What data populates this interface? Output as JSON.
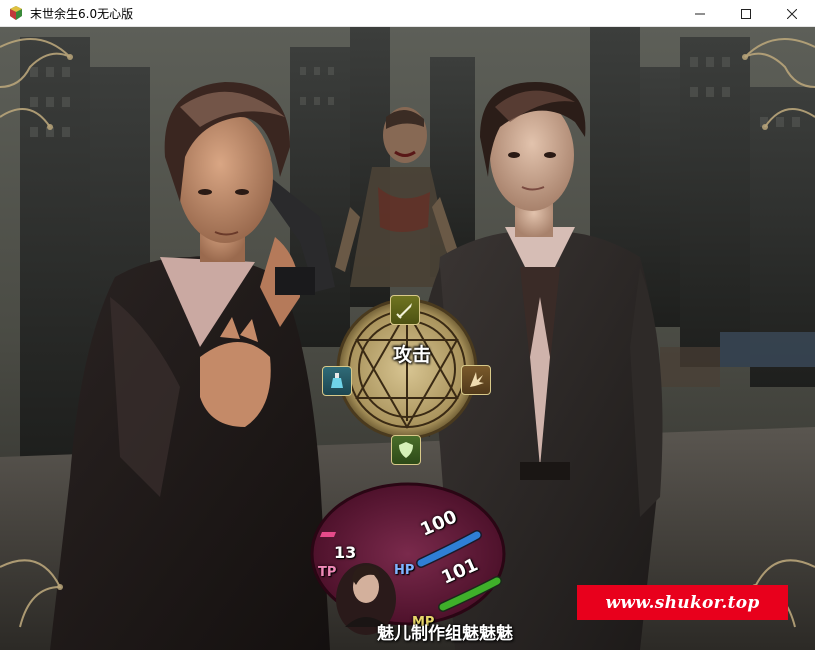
{
  "window": {
    "title": "末世余生6.0无心版",
    "icon": "rpg-app-icon",
    "controls": [
      "minimize-icon",
      "maximize-icon",
      "close-icon"
    ]
  },
  "battle_menu": {
    "selected_command": "攻击",
    "icons": {
      "top": "sword-icon",
      "left": "potion-icon",
      "right": "burst-icon",
      "bottom": "shield-icon"
    }
  },
  "status": {
    "tp_value": "13",
    "tp_label": "TP",
    "hp_value": "100",
    "hp_label": "HP",
    "mp_value": "101",
    "mp_label": "MP",
    "hp_color": "#2f7fd6",
    "mp_color": "#3fb02a",
    "tp_color": "#e64b8a"
  },
  "credits": "魅儿制作组魅魅魅",
  "watermark": "www.shukor.top"
}
